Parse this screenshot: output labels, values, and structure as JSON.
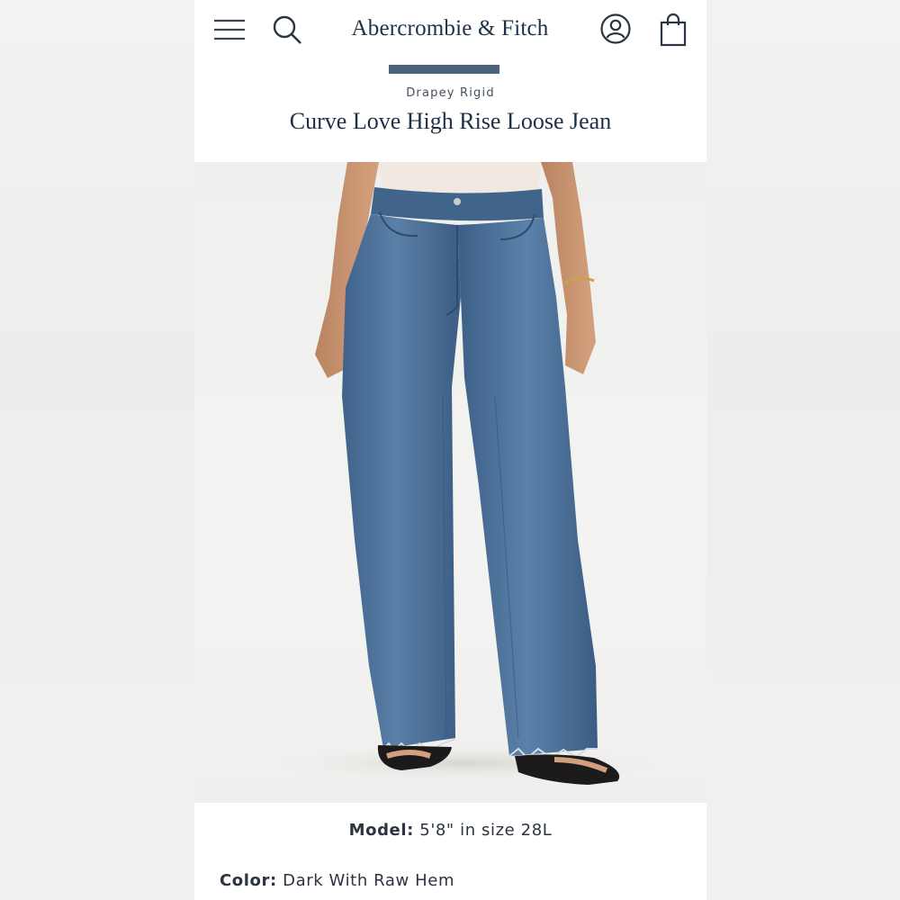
{
  "header": {
    "brand": "Abercrombie & Fitch",
    "icons": {
      "menu": "menu-icon",
      "search": "search-icon",
      "account": "account-icon",
      "bag": "shopping-bag-icon"
    }
  },
  "product": {
    "eyebrow": "Drapey Rigid",
    "title": "Curve Love High Rise Loose Jean",
    "image": "model-wearing-loose-jeans",
    "model_label": "Model:",
    "model_value": "5'8\" in size 28L",
    "color_label": "Color:",
    "color_value": "Dark With Raw Hem"
  },
  "colors": {
    "brand": "#1f3047",
    "accent": "#4a637e",
    "denim": "#4b6f96"
  }
}
